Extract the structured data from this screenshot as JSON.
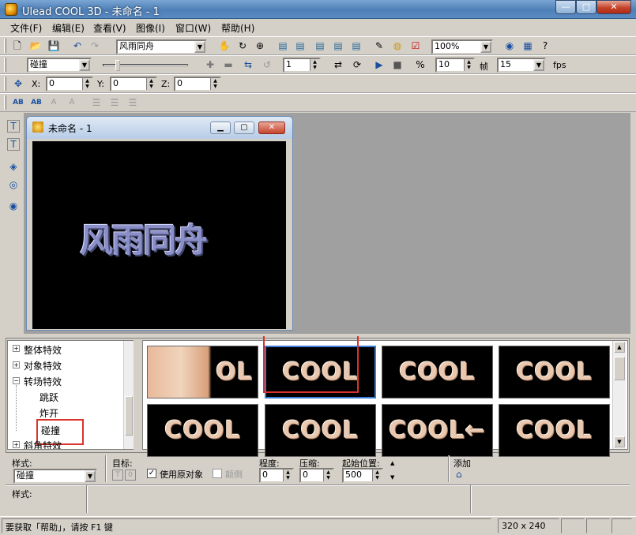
{
  "window": {
    "title": "Ulead COOL 3D - 未命名 - 1",
    "min": "—",
    "max": "□",
    "close": "✕"
  },
  "menu": [
    "文件(F)",
    "编辑(E)",
    "查看(V)",
    "图像(I)",
    "窗口(W)",
    "帮助(H)"
  ],
  "toolbar1": {
    "text_combo": "风雨同舟",
    "zoom": "100%"
  },
  "toolbar2": {
    "effect_combo": "碰撞",
    "frame": "1",
    "fps_frames": "10",
    "frame_label": "帧",
    "fps_value": "15",
    "fps_label": "fps"
  },
  "toolbar3": {
    "x_label": "X:",
    "x": "0",
    "y_label": "Y:",
    "y": "0",
    "z_label": "Z:",
    "z": "0"
  },
  "toolbar4": {
    "ab1": "AB",
    "ab2": "AB",
    "a1": "A",
    "a2": "A"
  },
  "child": {
    "title": "未命名 - 1",
    "canvas_text": "风雨同舟"
  },
  "tree": [
    {
      "label": "整体特效",
      "expander": "+"
    },
    {
      "label": "对象特效",
      "expander": "+"
    },
    {
      "label": "转场特效",
      "expander": "−"
    },
    {
      "label": "跳跃",
      "expander": ""
    },
    {
      "label": "炸开",
      "expander": ""
    },
    {
      "label": "碰撞",
      "expander": ""
    },
    {
      "label": "斜角特效",
      "expander": "+"
    }
  ],
  "thumbs": [
    {
      "text": "OL"
    },
    {
      "text": "COOL"
    },
    {
      "text": "COOL"
    },
    {
      "text": "COOL"
    },
    {
      "text": "COOL"
    },
    {
      "text": "COOL"
    },
    {
      "text": "COOL←"
    },
    {
      "text": "COOL"
    }
  ],
  "attrs": {
    "style_label": "样式:",
    "style_value": "碰撞",
    "target_label": "目标:",
    "target_t": "T",
    "target_o": "0",
    "use_original_label": "使用原对象",
    "invert_label": "颠倒",
    "degree_label": "程度:",
    "degree": "0",
    "compress_label": "压缩:",
    "compress": "0",
    "start_label": "起始位置:",
    "start": "500",
    "add_label": "添加",
    "style2_label": "样式:"
  },
  "status": {
    "help": "要获取「帮助」，请按 F1 键",
    "size": "320 x 240"
  },
  "colors": {
    "accent_red": "#d9332b",
    "canvas_bg": "#000000",
    "title_blue": "#4f7fb7"
  }
}
